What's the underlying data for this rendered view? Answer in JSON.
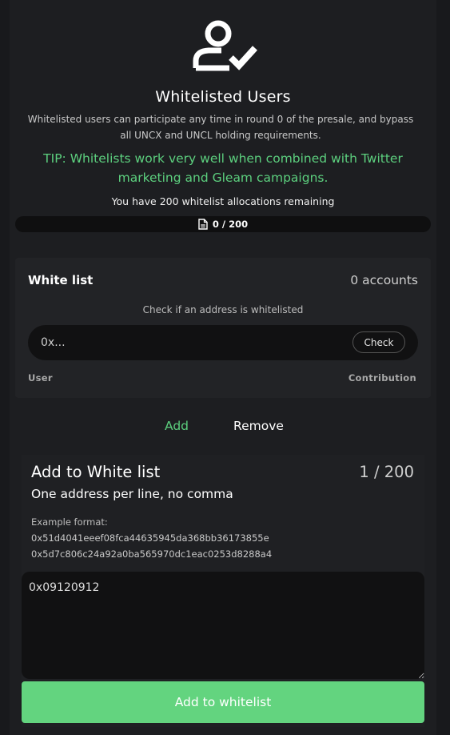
{
  "header": {
    "icon": "user-check-icon",
    "title": "Whitelisted Users",
    "description": "Whitelisted users can participate any time in round 0 of the presale, and bypass all UNCX and UNCL holding requirements.",
    "tip": "TIP: Whitelists work very well when combined with Twitter marketing and Gleam campaigns.",
    "remaining": "You have 200 whitelist allocations remaining",
    "progress": {
      "label": "0 / 200",
      "fraction": 0,
      "icon": "document-icon"
    }
  },
  "whitelist_card": {
    "title": "White list",
    "count": "0 accounts",
    "check_label": "Check if an address is whitelisted",
    "check_placeholder": "0x...",
    "check_button": "Check",
    "columns": {
      "user": "User",
      "contribution": "Contribution"
    }
  },
  "tabs": {
    "add": "Add",
    "remove": "Remove"
  },
  "add_panel": {
    "title": "Add to White list",
    "counter": "1 / 200",
    "subtitle": "One address per line, no comma",
    "example_label": "Example format:",
    "example_lines": [
      "0x51d4041eeef08fca44635945da368bb36173855e",
      "0x5d7c806c24a92a0ba565970dc1eac0253d8288a4"
    ],
    "textarea_value": "0x09120912",
    "submit_button": "Add to whitelist"
  },
  "colors": {
    "accent": "#5ccf7e",
    "button": "#63d47f",
    "background": "#18191c"
  }
}
